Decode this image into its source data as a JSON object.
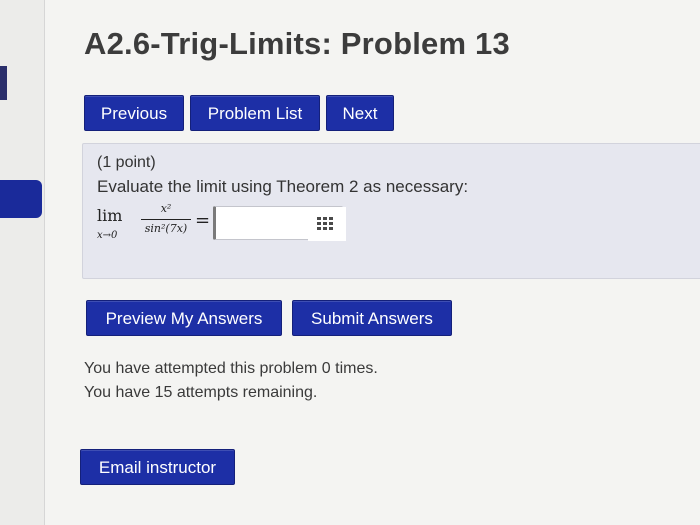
{
  "page": {
    "title": "A2.6-Trig-Limits: Problem 13"
  },
  "nav": {
    "previous_label": "Previous",
    "problem_list_label": "Problem List",
    "next_label": "Next"
  },
  "problem": {
    "points": "(1 point)",
    "prompt": "Evaluate the limit using Theorem 2 as necessary:",
    "math": {
      "lim": "lim",
      "limit_sub": "x→0",
      "numerator": "x²",
      "denominator": "sin²(7x)",
      "equals": "="
    },
    "answer_value": "",
    "grid_icon": "grid-icon"
  },
  "actions": {
    "preview_label": "Preview My Answers",
    "submit_label": "Submit Answers",
    "email_label": "Email instructor"
  },
  "status": {
    "attempted": "You have attempted this problem 0 times.",
    "remaining": "You have 15 attempts remaining."
  },
  "colors": {
    "button_bg": "#1d2fa6",
    "panel_bg": "#e6e7ef"
  }
}
